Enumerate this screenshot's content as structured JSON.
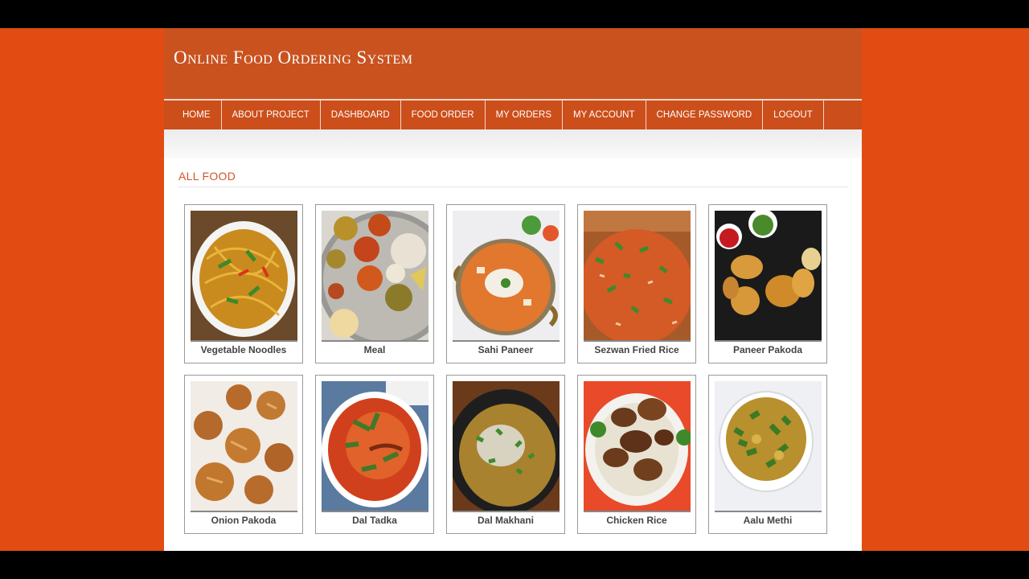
{
  "header": {
    "title": "Online Food Ordering System"
  },
  "nav": [
    {
      "label": "HOME"
    },
    {
      "label": "ABOUT PROJECT"
    },
    {
      "label": "DASHBOARD"
    },
    {
      "label": "FOOD ORDER"
    },
    {
      "label": "MY ORDERS"
    },
    {
      "label": "MY ACCOUNT"
    },
    {
      "label": "CHANGE PASSWORD"
    },
    {
      "label": "LOGOUT"
    }
  ],
  "section": {
    "title": "ALL FOOD"
  },
  "foods": [
    {
      "name": "Vegetable Noodles"
    },
    {
      "name": "Meal"
    },
    {
      "name": "Sahi Paneer"
    },
    {
      "name": "Sezwan Fried Rice"
    },
    {
      "name": "Paneer Pakoda"
    },
    {
      "name": "Onion Pakoda"
    },
    {
      "name": "Dal Tadka"
    },
    {
      "name": "Dal Makhani"
    },
    {
      "name": "Chicken Rice"
    },
    {
      "name": "Aalu Methi"
    }
  ],
  "colors": {
    "page_background": "#e24c12",
    "header": "#c9521f",
    "nav": "#cc4e1a",
    "section_title": "#d2542a"
  }
}
